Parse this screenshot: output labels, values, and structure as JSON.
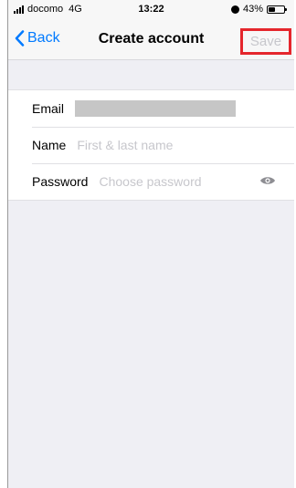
{
  "status_bar": {
    "carrier": "docomo",
    "network": "4G",
    "time": "13:22",
    "battery_percent": "43%",
    "battery_level": 0.43
  },
  "nav": {
    "back_label": "Back",
    "title": "Create account",
    "save_label": "Save"
  },
  "form": {
    "email": {
      "label": "Email",
      "value": ""
    },
    "name": {
      "label": "Name",
      "placeholder": "First & last name"
    },
    "password": {
      "label": "Password",
      "placeholder": "Choose password"
    }
  },
  "colors": {
    "accent": "#007aff",
    "highlight": "#e5262c",
    "placeholder": "#c7c7cc",
    "background": "#efeff4"
  },
  "icons": [
    "back-chevron-icon",
    "signal-icon",
    "alarm-icon",
    "battery-icon",
    "eye-icon"
  ]
}
